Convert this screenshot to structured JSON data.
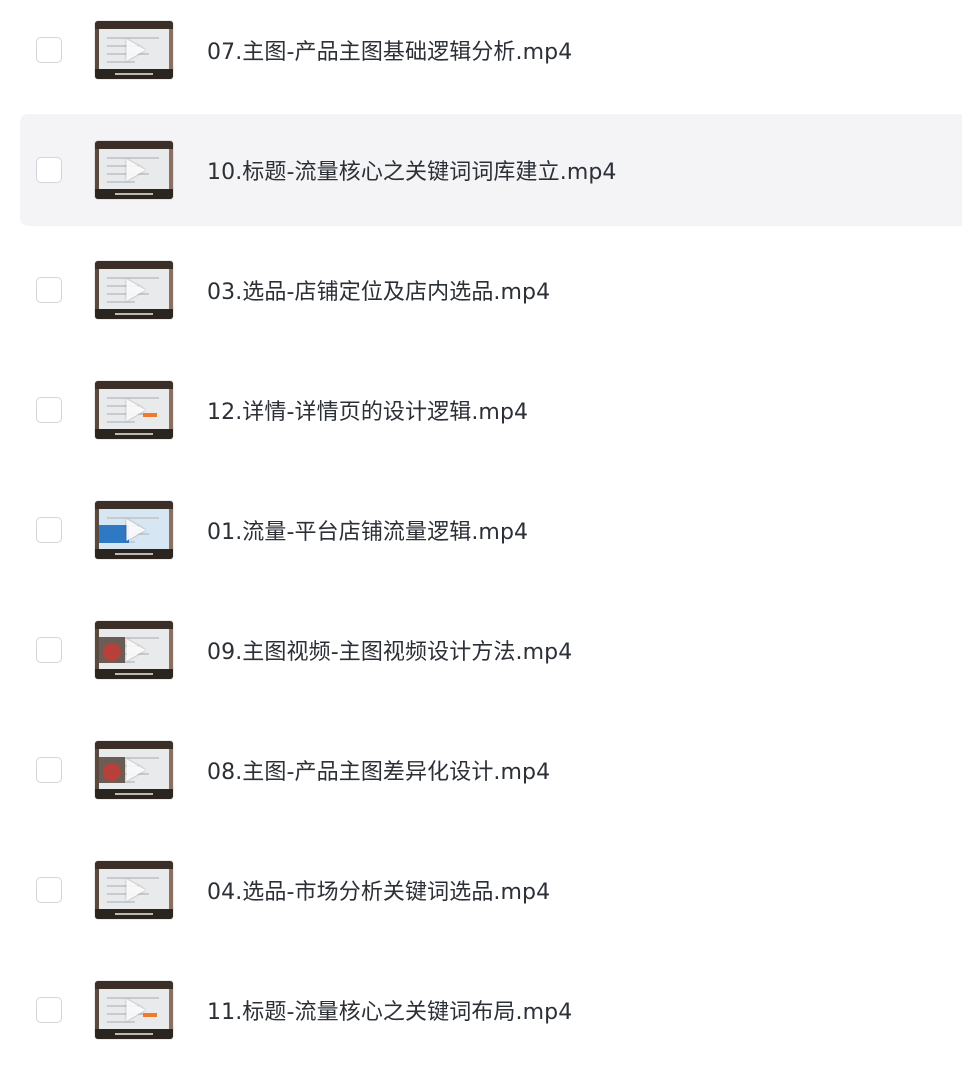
{
  "files": [
    {
      "name": "07.主图-产品主图基础逻辑分析.mp4",
      "highlighted": false,
      "thumb": "default"
    },
    {
      "name": "10.标题-流量核心之关键词词库建立.mp4",
      "highlighted": true,
      "thumb": "default"
    },
    {
      "name": "03.选品-店铺定位及店内选品.mp4",
      "highlighted": false,
      "thumb": "default"
    },
    {
      "name": "12.详情-详情页的设计逻辑.mp4",
      "highlighted": false,
      "thumb": "orange"
    },
    {
      "name": "01.流量-平台店铺流量逻辑.mp4",
      "highlighted": false,
      "thumb": "blue"
    },
    {
      "name": "09.主图视频-主图视频设计方法.mp4",
      "highlighted": false,
      "thumb": "photo"
    },
    {
      "name": "08.主图-产品主图差异化设计.mp4",
      "highlighted": false,
      "thumb": "photo"
    },
    {
      "name": "04.选品-市场分析关键词选品.mp4",
      "highlighted": false,
      "thumb": "default"
    },
    {
      "name": "11.标题-流量核心之关键词布局.mp4",
      "highlighted": false,
      "thumb": "orange"
    }
  ],
  "icons": {
    "checkbox": "checkbox-icon",
    "play": "play-icon"
  },
  "colors": {
    "highlight_bg": "#f4f4f6",
    "text": "#2b2f36",
    "checkbox_border": "#d3d5da"
  }
}
